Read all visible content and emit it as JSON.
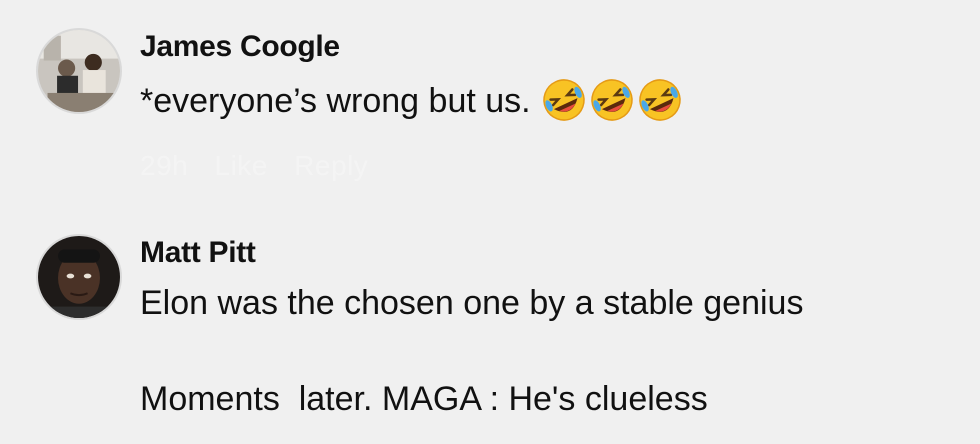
{
  "comments": [
    {
      "author": "James Coogle",
      "text": "*everyone’s wrong but us.",
      "emoji": [
        "rolling-on-floor-laughing",
        "rolling-on-floor-laughing",
        "rolling-on-floor-laughing"
      ],
      "actions": {
        "time": "29h",
        "like": "Like",
        "reply": "Reply"
      }
    },
    {
      "author": "Matt Pitt",
      "line1": "Elon was the chosen one by a stable genius",
      "line2": "Moments  later. MAGA : He's clueless"
    }
  ]
}
